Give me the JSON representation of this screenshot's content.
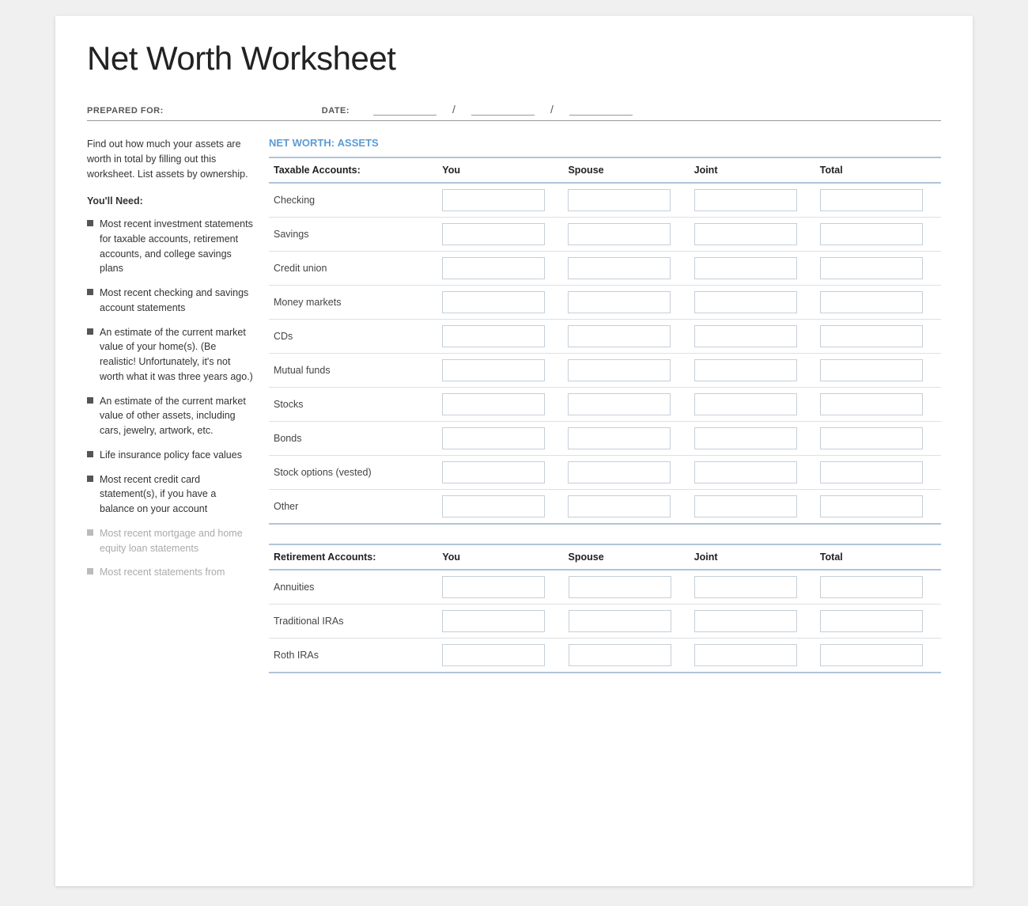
{
  "page": {
    "title": "Net Worth Worksheet",
    "prepared_for_label": "PREPARED FOR:",
    "date_label": "DATE:",
    "date_slash1": "/",
    "date_slash2": "/"
  },
  "sidebar": {
    "intro": "Find out how much your assets are worth in total by filling out this worksheet. List assets by ownership.",
    "need_title": "You'll Need:",
    "items": [
      {
        "text": "Most recent investment statements for taxable accounts, retirement accounts, and college savings plans",
        "faded": false
      },
      {
        "text": "Most recent checking and savings account statements",
        "faded": false
      },
      {
        "text": "An estimate of the current market value of your home(s). (Be realistic! Unfortunately, it's not worth what it was three years ago.)",
        "faded": false
      },
      {
        "text": "An estimate of the current market value of other assets, including cars, jewelry, artwork, etc.",
        "faded": false
      },
      {
        "text": "Life insurance policy face values",
        "faded": false
      },
      {
        "text": "Most recent credit card statement(s), if you have a balance on your account",
        "faded": false
      },
      {
        "text": "Most recent mortgage and home equity loan statements",
        "faded": true
      },
      {
        "text": "Most recent statements from",
        "faded": true
      }
    ]
  },
  "assets_section": {
    "header_label": "NET WORTH:",
    "header_highlight": "ASSETS",
    "taxable": {
      "title": "Taxable Accounts:",
      "columns": [
        "You",
        "Spouse",
        "Joint",
        "Total"
      ],
      "rows": [
        "Checking",
        "Savings",
        "Credit union",
        "Money markets",
        "CDs",
        "Mutual funds",
        "Stocks",
        "Bonds",
        "Stock options (vested)",
        "Other"
      ]
    },
    "retirement": {
      "title": "Retirement Accounts:",
      "columns": [
        "You",
        "Spouse",
        "Joint",
        "Total"
      ],
      "rows": [
        "Annuities",
        "Traditional IRAs",
        "Roth IRAs"
      ]
    }
  }
}
